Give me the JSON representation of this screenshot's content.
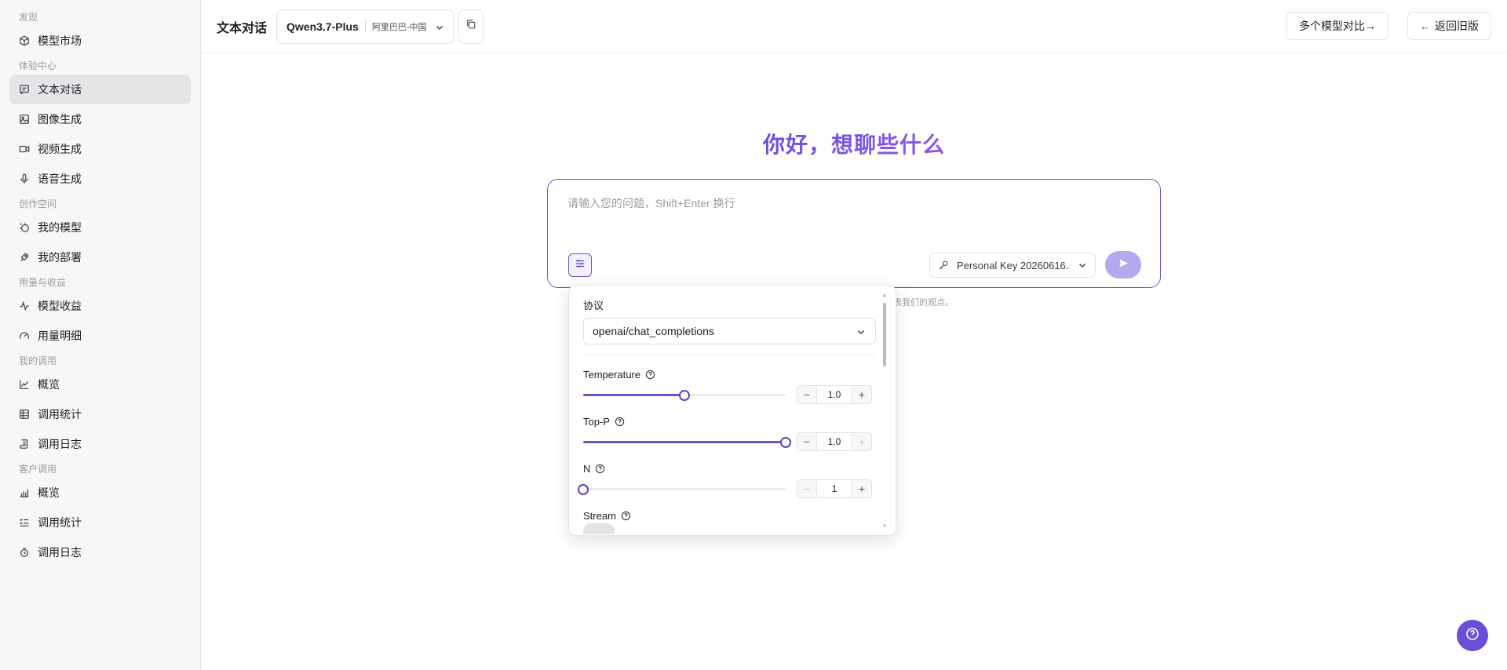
{
  "sidebar": {
    "sections": [
      {
        "title": "发现",
        "items": [
          {
            "label": "模型市场",
            "icon": "cube-icon"
          }
        ]
      },
      {
        "title": "体验中心",
        "items": [
          {
            "label": "文本对话",
            "icon": "chat-icon",
            "active": true
          },
          {
            "label": "图像生成",
            "icon": "image-icon"
          },
          {
            "label": "视频生成",
            "icon": "video-icon"
          },
          {
            "label": "语音生成",
            "icon": "mic-icon"
          }
        ]
      },
      {
        "title": "创作空间",
        "items": [
          {
            "label": "我的模型",
            "icon": "model-icon"
          },
          {
            "label": "我的部署",
            "icon": "rocket-icon"
          }
        ]
      },
      {
        "title": "用量与收益",
        "items": [
          {
            "label": "模型收益",
            "icon": "activity-icon"
          },
          {
            "label": "用量明细",
            "icon": "gauge-icon"
          }
        ]
      },
      {
        "title": "我的调用",
        "items": [
          {
            "label": "概览",
            "icon": "line-chart-icon"
          },
          {
            "label": "调用统计",
            "icon": "table-icon"
          },
          {
            "label": "调用日志",
            "icon": "scroll-icon"
          }
        ]
      },
      {
        "title": "客户调用",
        "items": [
          {
            "label": "概览",
            "icon": "bar-chart-icon"
          },
          {
            "label": "调用统计",
            "icon": "list-check-icon"
          },
          {
            "label": "调用日志",
            "icon": "log-icon"
          }
        ]
      }
    ]
  },
  "header": {
    "title": "文本对话",
    "model_name": "Qwen3.7-Plus",
    "model_region": "阿里巴巴-中国",
    "compare_label": "多个模型对比→",
    "back_label": "返回旧版"
  },
  "main": {
    "greeting": "你好，想聊些什么",
    "input_placeholder": "请输入您的问题，Shift+Enter 换行",
    "key_label": "Personal Key 20260616...",
    "disclaimer": "表我们的观点。"
  },
  "params": {
    "protocol_label": "协议",
    "protocol_value": "openai/chat_completions",
    "temperature": {
      "label": "Temperature",
      "value": "1.0",
      "fraction": 0.5
    },
    "top_p": {
      "label": "Top-P",
      "value": "1.0",
      "fraction": 1.0
    },
    "n": {
      "label": "N",
      "value": "1",
      "fraction": 0.0
    },
    "stream_label": "Stream"
  },
  "colors": {
    "accent": "#6a55c8",
    "greeting": "#7a55e0",
    "send_disabled": "#b3a9ef",
    "fab": "#6a4fd6"
  }
}
